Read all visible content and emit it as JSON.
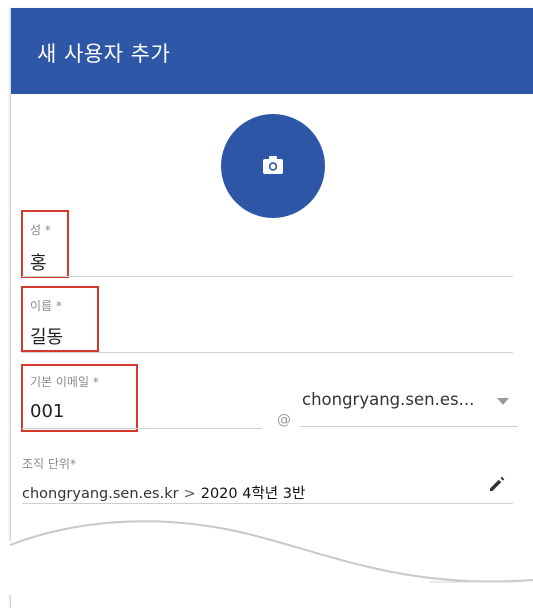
{
  "dialog": {
    "title": "새 사용자 추가"
  },
  "photo": {
    "icon": "camera-icon",
    "color": "#2d57a6"
  },
  "fields": {
    "last_name": {
      "label": "성 *",
      "value": "홍"
    },
    "first_name": {
      "label": "이름 *",
      "value": "길동"
    },
    "email": {
      "label": "기본 이메일 *",
      "value": "001",
      "at": "@",
      "domain": "chongryang.sen.es..."
    },
    "org_unit": {
      "label": "조직 단위*",
      "root": "chongryang.sen.es.kr",
      "separator": ">",
      "unit": "2020 4학년 3반",
      "edit_icon": "pencil-icon"
    }
  },
  "colors": {
    "header": "#2f57a7",
    "highlight": "#d33a2c"
  }
}
